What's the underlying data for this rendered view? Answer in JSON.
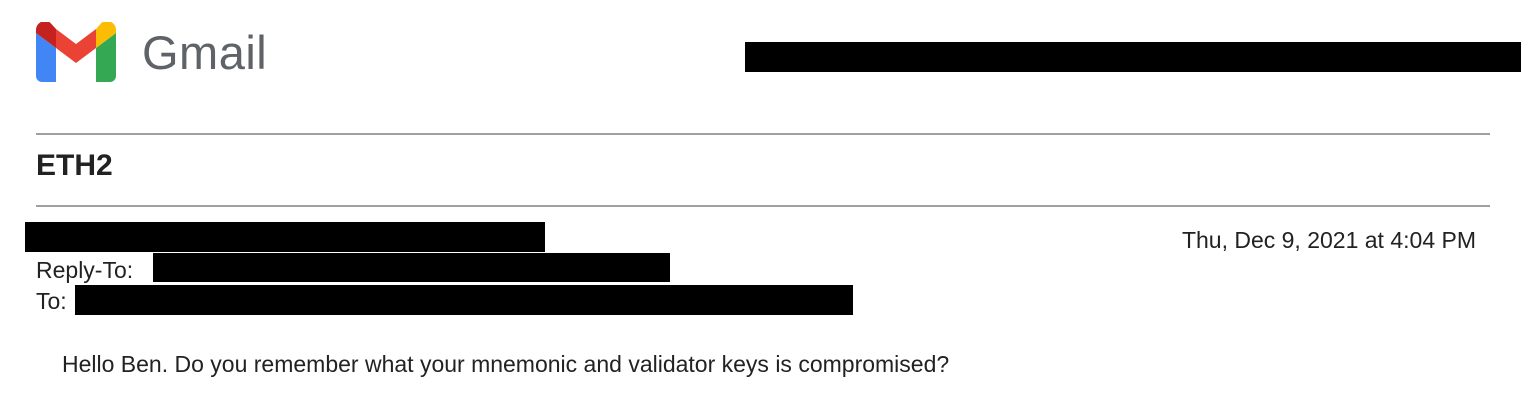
{
  "app": {
    "name": "Gmail",
    "logo_icon": "gmail-m-icon"
  },
  "message": {
    "subject": "ETH2",
    "date": "Thu, Dec 9, 2021 at 4:04 PM",
    "reply_to_label": "Reply-To:",
    "to_label": "To:",
    "body": "Hello Ben. Do you remember what your mnemonic and validator keys is compromised?"
  },
  "colors": {
    "redaction": "#000000",
    "gmail_red": "#ea4335",
    "gmail_blue": "#4285f4",
    "gmail_green": "#34a853",
    "gmail_yellow": "#fbbc04",
    "gmail_dark_red": "#c5221f",
    "rule": "#a0a0a0"
  }
}
